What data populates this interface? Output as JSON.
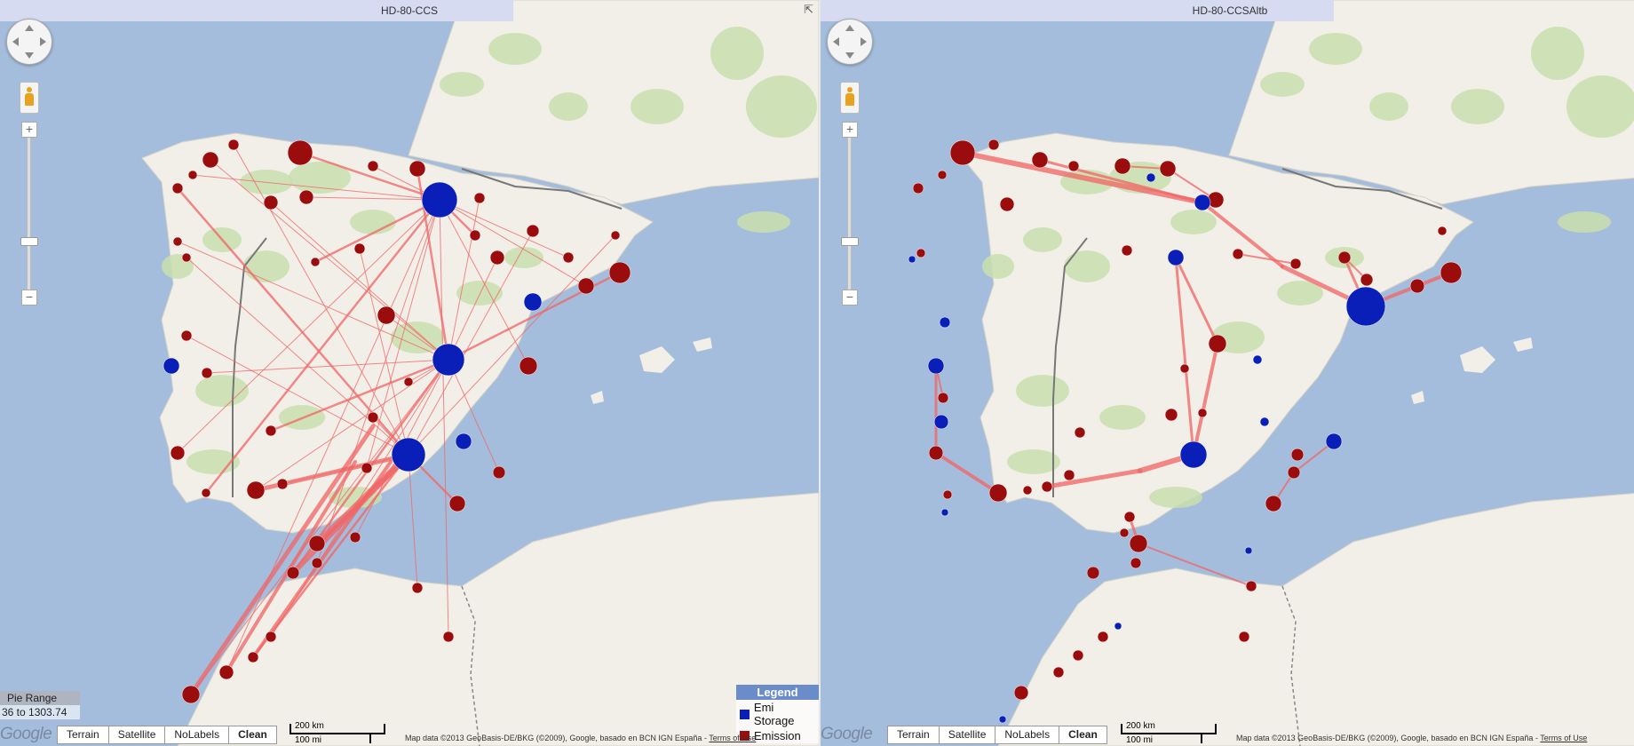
{
  "panels": [
    {
      "id": "left",
      "title": "HD-80-CCS",
      "flows_density": "dense",
      "show_pie_range": true,
      "show_legend": true
    },
    {
      "id": "right",
      "title": "HD-80-CCSAltb",
      "flows_density": "sparse",
      "show_pie_range": false,
      "show_legend": false
    }
  ],
  "map_types": [
    "Terrain",
    "Satellite",
    "NoLabels",
    "Clean"
  ],
  "active_map_type": "Clean",
  "google_logo": "Google",
  "scale": {
    "km": "200 km",
    "mi": "100 mi"
  },
  "attribution": "Map data ©2013 GeoBasis-DE/BKG (©2009), Google, basado en BCN IGN España -",
  "terms_label": "Terms of Use",
  "pie_range": {
    "label": "Pie Range",
    "value": "36 to 1303.74"
  },
  "legend": {
    "title": "Legend",
    "items": [
      {
        "label": "Emi Storage",
        "color": "#0a1fb8"
      },
      {
        "label": "Emission",
        "color": "#9b0d0d"
      }
    ]
  },
  "colors": {
    "sea": "#a4bddc",
    "land": "#f1efe8",
    "forest": "#c9dfae",
    "storage": "#0a1fb8",
    "emission": "#9b0d0d",
    "flow": "#f26464"
  },
  "icons": [
    "pan-control-icon",
    "pegman-icon",
    "zoom-in-icon",
    "zoom-out-icon",
    "popout-icon"
  ]
}
